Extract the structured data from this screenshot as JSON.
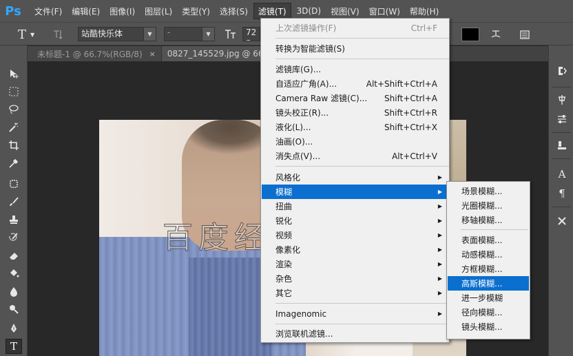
{
  "app": {
    "logo": "Ps"
  },
  "menubar": {
    "items": [
      "文件(F)",
      "编辑(E)",
      "图像(I)",
      "图层(L)",
      "类型(Y)",
      "选择(S)",
      "滤镜(T)",
      "3D(D)",
      "视图(V)",
      "窗口(W)",
      "帮助(H)"
    ],
    "active_index": 6
  },
  "options": {
    "tool_glyph": "T",
    "font_family": "站酷快乐体",
    "font_style": "-",
    "font_size": "72 p"
  },
  "tabs": [
    {
      "label": "未标题-1 @ 66.7%(RGB/8)",
      "close": "×",
      "active": false
    },
    {
      "label": "0827_145529.jpg @ 66.7",
      "close": "",
      "active": true
    }
  ],
  "canvas": {
    "watermark_text": "百度经"
  },
  "filter_menu": {
    "last_filter": {
      "label": "上次滤镜操作(F)",
      "shortcut": "Ctrl+F"
    },
    "convert_smart": "转换为智能滤镜(S)",
    "group1": [
      {
        "label": "滤镜库(G)...",
        "shortcut": ""
      },
      {
        "label": "自适应广角(A)...",
        "shortcut": "Alt+Shift+Ctrl+A"
      },
      {
        "label": "Camera Raw 滤镜(C)...",
        "shortcut": "Shift+Ctrl+A"
      },
      {
        "label": "镜头校正(R)...",
        "shortcut": "Shift+Ctrl+R"
      },
      {
        "label": "液化(L)...",
        "shortcut": "Shift+Ctrl+X"
      },
      {
        "label": "油画(O)...",
        "shortcut": ""
      },
      {
        "label": "消失点(V)...",
        "shortcut": "Alt+Ctrl+V"
      }
    ],
    "submenus": [
      "风格化",
      "模糊",
      "扭曲",
      "锐化",
      "视频",
      "像素化",
      "渲染",
      "杂色",
      "其它"
    ],
    "highlighted_submenu_index": 1,
    "plugin": "Imagenomic",
    "browse": "浏览联机滤镜..."
  },
  "blur_menu": {
    "group1": [
      "场景模糊...",
      "光圈模糊...",
      "移轴模糊..."
    ],
    "group2": [
      "表面模糊...",
      "动感模糊...",
      "方框模糊...",
      "高斯模糊...",
      "进一步模糊",
      "径向模糊...",
      "镜头模糊..."
    ],
    "highlighted_label": "高斯模糊..."
  },
  "colors": {
    "highlight": "#0b6fcf",
    "menu_bg": "#f0f0f0",
    "chrome": "#535353",
    "logo_blue": "#31a8ff"
  }
}
